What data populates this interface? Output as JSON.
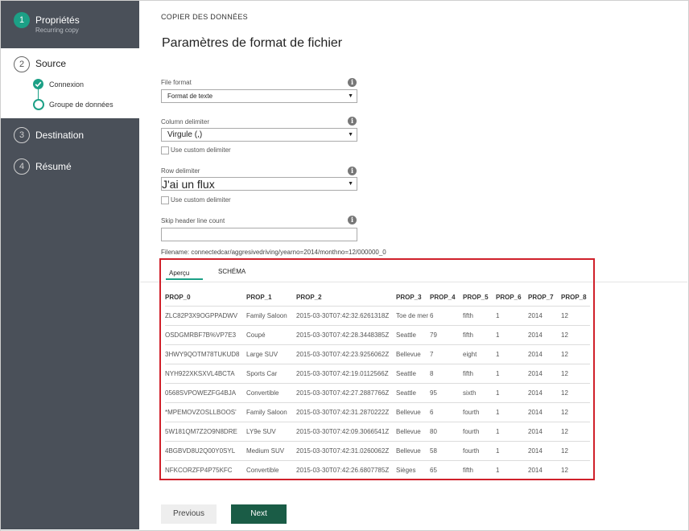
{
  "sidebar": {
    "steps": [
      {
        "num": "1",
        "title": "Propriétés",
        "subtitle": "Recurring copy"
      },
      {
        "num": "2",
        "title": "Source"
      },
      {
        "num": "3",
        "title": "Destination"
      },
      {
        "num": "4",
        "title": "Résumé"
      }
    ],
    "source_substeps": [
      "Connexion",
      "Groupe de données"
    ]
  },
  "header": {
    "breadcrumb": "COPIER DES DONNÉES",
    "title": "Paramètres de format de fichier"
  },
  "form": {
    "file_format": {
      "label": "File format",
      "value": "Format de texte"
    },
    "column_delimiter": {
      "label": "Column delimiter",
      "value": "Virgule  (,)",
      "custom_label": "Use custom delimiter"
    },
    "row_delimiter": {
      "label": "Row delimiter",
      "value": "J'ai un flux",
      "custom_label": "Use custom delimiter"
    },
    "skip_header": {
      "label": "Skip header line count",
      "value": ""
    },
    "filename": "Filename: connectedcar/aggresivedriving/yearno=2014/monthno=12/000000_0"
  },
  "preview": {
    "tabs": [
      "Aperçu",
      "SCHÉMA"
    ],
    "columns": [
      "PROP_0",
      "PROP_1",
      "PROP_2",
      "PROP_3",
      "PROP_4",
      "PROP_5",
      "PROP_6",
      "PROP_7",
      "PROP_8"
    ],
    "rows": [
      [
        "ZLC82P3X9OGPPADWV",
        "Family Saloon",
        "2015-03-30T07:42:32.6261318Z",
        "Toe de mer",
        "6",
        "fifth",
        "1",
        "2014",
        "12"
      ],
      [
        "OSDGMRBF7B%VP7E3",
        "Coupé",
        "2015-03-30T07:42:28.3448385Z",
        "Seattle",
        "79",
        "fifth",
        "1",
        "2014",
        "12"
      ],
      [
        "3HWY9QOTM78TUKUD8",
        "Large SUV",
        "2015-03-30T07:42:23.9256062Z",
        "Bellevue",
        "7",
        "eight",
        "1",
        "2014",
        "12"
      ],
      [
        "NYH922XKSXVL4BCTA",
        "Sports Car",
        "2015-03-30T07:42:19.0112566Z",
        "Seattle",
        "8",
        "fifth",
        "1",
        "2014",
        "12"
      ],
      [
        "0568SVPOWEZFG4BJA",
        "Convertible",
        "2015-03-30T07:42:27.2887766Z",
        "Seattle",
        "95",
        "sixth",
        "1",
        "2014",
        "12"
      ],
      [
        "*MPEMOVZOSLLBOOS'",
        "Family Saloon",
        "2015-03-30T07:42:31.2870222Z",
        "Bellevue",
        "6",
        "fourth",
        "1",
        "2014",
        "12"
      ],
      [
        "5W181QM7Z2O9N8DRE",
        "LY9e SUV",
        "2015-03-30T07:42:09.3066541Z",
        "Bellevue",
        "80",
        "fourth",
        "1",
        "2014",
        "12"
      ],
      [
        "4BGBVD8U2Q00Y0SYL",
        "Medium SUV",
        "2015-03-30T07:42:31.0260062Z",
        "Bellevue",
        "58",
        "fourth",
        "1",
        "2014",
        "12"
      ],
      [
        "NFKCORZFP4P75KFC",
        "Convertible",
        "2015-03-30T07:42:26.6807785Z",
        "Sièges",
        "65",
        "fifth",
        "1",
        "2014",
        "12"
      ]
    ]
  },
  "buttons": {
    "previous": "Previous",
    "next": "Next"
  },
  "colors": {
    "accent": "#1ca086",
    "sidebar": "#4a5059",
    "next_button": "#1a5c46",
    "highlight_border": "#d0202a"
  }
}
